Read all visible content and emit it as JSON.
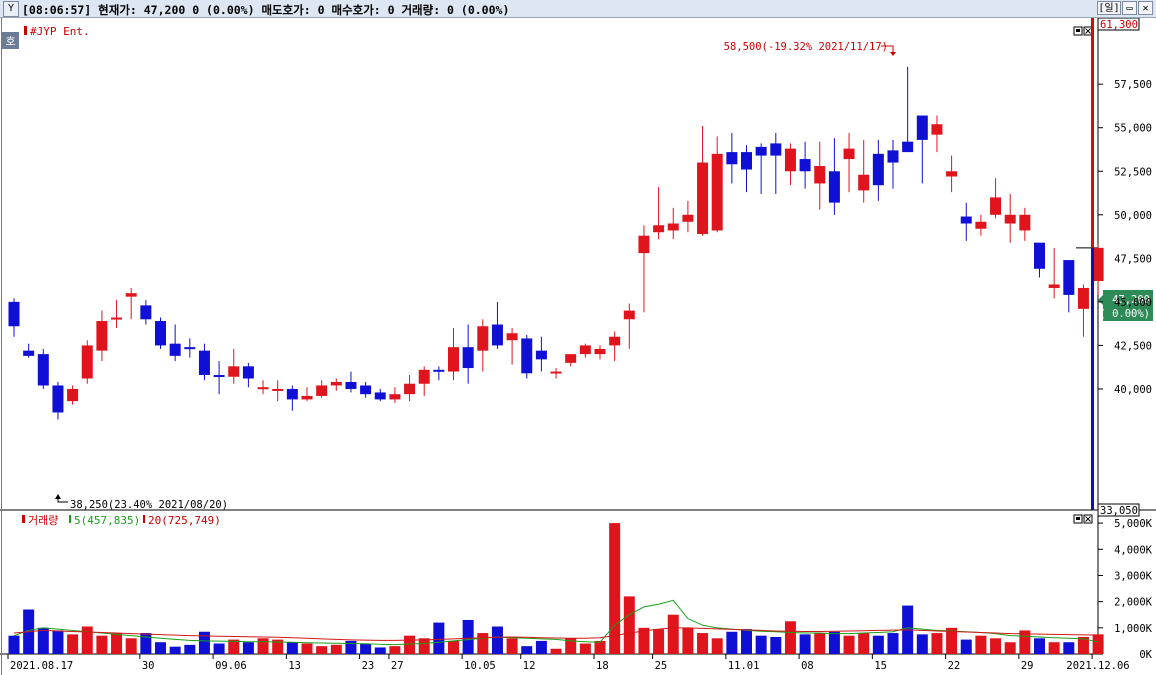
{
  "window": {
    "status_text": "[08:06:57] 현재가: 47,200 0 (0.00%) 매도호가: 0 매수호가: 0 거래량: 0 (0.00%)",
    "period_button": "[일]",
    "logo_glyph": "Y",
    "side_tab": "호"
  },
  "price_panel": {
    "legend": "#JYP Ent.",
    "legend_color": "#cc0000",
    "axis_top": "61,300",
    "axis_bottom": "33,050",
    "ticks": [
      "57,500",
      "55,000",
      "52,500",
      "50,000",
      "47,500",
      "45,000",
      "42,500",
      "40,000"
    ],
    "current_label": "47,200",
    "current_change": "( 0.00%)",
    "high_annotation": "58,500(-19.32% 2021/11/17)",
    "low_annotation": "38,250(23.40% 2021/08/20)"
  },
  "volume_panel": {
    "legend_title": "거래량",
    "ma5_label": "5(457,835)",
    "ma20_label": "20(725,749)",
    "ticks": [
      "5,000K",
      "4,000K",
      "3,000K",
      "2,000K",
      "1,000K",
      "0K"
    ]
  },
  "x_axis": {
    "labels": [
      "2021.08.17",
      "30",
      "09.06",
      "13",
      "23",
      "27",
      "10.05",
      "12",
      "18",
      "25",
      "11.01",
      "08",
      "15",
      "22",
      "29",
      "2021.12.06"
    ]
  },
  "colors": {
    "up": "#e0141c",
    "down": "#0f0fd6",
    "ma5": "#18a018",
    "ma20": "#d01818",
    "current": "#2e8b57"
  },
  "chart_data": [
    {
      "type": "candlestick",
      "title": "#JYP Ent.",
      "ylim": [
        33050,
        61300
      ],
      "x": [
        "08.17",
        "08.18",
        "08.19",
        "08.20",
        "08.23",
        "08.24",
        "08.25",
        "08.26",
        "08.27",
        "08.30",
        "08.31",
        "09.01",
        "09.02",
        "09.03",
        "09.06",
        "09.07",
        "09.08",
        "09.09",
        "09.10",
        "09.13",
        "09.14",
        "09.15",
        "09.16",
        "09.17",
        "09.23",
        "09.24",
        "09.27",
        "09.28",
        "09.29",
        "09.30",
        "10.01",
        "10.05",
        "10.06",
        "10.07",
        "10.08",
        "10.12",
        "10.13",
        "10.14",
        "10.15",
        "10.18",
        "10.19",
        "10.20",
        "10.21",
        "10.22",
        "10.25",
        "10.26",
        "10.27",
        "10.28",
        "10.29",
        "11.01",
        "11.02",
        "11.03",
        "11.04",
        "11.05",
        "11.08",
        "11.09",
        "11.10",
        "11.11",
        "11.12",
        "11.15",
        "11.16",
        "11.17",
        "11.18",
        "11.19",
        "11.22",
        "11.23",
        "11.24",
        "11.25",
        "11.26",
        "11.29",
        "11.30",
        "12.01",
        "12.02",
        "12.03",
        "12.06"
      ],
      "open": [
        45000,
        42200,
        42000,
        40200,
        39300,
        40600,
        42200,
        44100,
        45300,
        44800,
        43900,
        42600,
        42400,
        42200,
        40800,
        40700,
        41300,
        40100,
        40000,
        40000,
        39400,
        39600,
        40200,
        40400,
        40200,
        39800,
        39400,
        39700,
        40300,
        41100,
        41000,
        42400,
        42200,
        43700,
        42800,
        42900,
        42200,
        40900,
        41500,
        42000,
        42000,
        42500,
        44000,
        47800,
        49000,
        49100,
        49600,
        48900,
        49100,
        53600,
        53600,
        53900,
        54100,
        52500,
        53200,
        51800,
        52500,
        53200,
        51400,
        53500,
        53700,
        54200,
        55700,
        54600,
        52200,
        49900,
        49200,
        50000,
        49500,
        49100,
        48400,
        45800,
        47400,
        44600,
        46200
      ],
      "close": [
        43600,
        41900,
        40200,
        38650,
        40000,
        42500,
        43900,
        44100,
        45500,
        44000,
        42500,
        41900,
        42300,
        40800,
        40700,
        41300,
        40600,
        40100,
        40000,
        39400,
        39600,
        40200,
        40400,
        40000,
        39700,
        39400,
        39700,
        40300,
        41100,
        41000,
        42400,
        41200,
        43600,
        42500,
        43200,
        40900,
        41700,
        41000,
        42000,
        42500,
        42300,
        43000,
        44500,
        48800,
        49400,
        49500,
        50000,
        53000,
        53500,
        52900,
        52600,
        53400,
        53400,
        53800,
        52500,
        52800,
        50700,
        53800,
        52300,
        51700,
        53000,
        53600,
        54300,
        55200,
        52500,
        49500,
        49600,
        51000,
        50000,
        50000,
        46900,
        46000,
        45400,
        45800,
        48100
      ],
      "high": [
        45200,
        42600,
        42300,
        40400,
        40200,
        42800,
        44500,
        45100,
        45800,
        45100,
        44100,
        43700,
        42900,
        42600,
        41600,
        42300,
        41500,
        40500,
        40500,
        40200,
        40100,
        40500,
        40600,
        41000,
        40400,
        40000,
        40100,
        40800,
        41300,
        41300,
        43500,
        43700,
        44000,
        45000,
        43500,
        43100,
        43000,
        41200,
        42000,
        42600,
        42500,
        43300,
        44900,
        49400,
        51600,
        50400,
        50800,
        55100,
        54500,
        54700,
        54000,
        54100,
        54700,
        54100,
        54200,
        54200,
        54400,
        54700,
        54300,
        54300,
        54300,
        58500,
        55700,
        55700,
        53400,
        50700,
        50000,
        52100,
        51200,
        50400,
        47000,
        48100,
        46700,
        46000,
        48300
      ],
      "low": [
        43000,
        41800,
        40000,
        38250,
        39100,
        40300,
        41600,
        43500,
        44000,
        43700,
        42300,
        41600,
        41800,
        40500,
        39700,
        40300,
        40100,
        39700,
        39300,
        38750,
        39300,
        39500,
        39900,
        39800,
        39500,
        39300,
        39200,
        39300,
        39600,
        40500,
        40500,
        40300,
        41000,
        42300,
        41400,
        40600,
        41000,
        40600,
        41300,
        41800,
        41700,
        41600,
        42300,
        44400,
        48600,
        48600,
        49000,
        48800,
        49000,
        51800,
        51300,
        51200,
        51200,
        51700,
        51500,
        50300,
        50000,
        51300,
        50700,
        50800,
        51500,
        53600,
        51800,
        53600,
        51300,
        48500,
        48800,
        49800,
        48400,
        48500,
        46400,
        45200,
        44400,
        43000,
        45400
      ],
      "annotations": [
        "58,500(-19.32% 2021/11/17)",
        "38,250(23.40% 2021/08/20)"
      ]
    },
    {
      "type": "bar",
      "title": "거래량",
      "ylim": [
        0,
        5500000
      ],
      "values": [
        700000,
        1700000,
        1000000,
        900000,
        750000,
        1050000,
        700000,
        800000,
        600000,
        800000,
        450000,
        280000,
        350000,
        850000,
        400000,
        550000,
        450000,
        600000,
        550000,
        450000,
        400000,
        300000,
        350000,
        500000,
        400000,
        250000,
        300000,
        700000,
        600000,
        1200000,
        500000,
        1300000,
        800000,
        1050000,
        600000,
        300000,
        500000,
        200000,
        600000,
        400000,
        500000,
        5000000,
        2200000,
        1000000,
        950000,
        1500000,
        1000000,
        800000,
        600000,
        850000,
        950000,
        700000,
        650000,
        1250000,
        750000,
        800000,
        850000,
        700000,
        800000,
        700000,
        800000,
        1850000,
        750000,
        800000,
        1000000,
        550000,
        700000,
        600000,
        450000,
        900000,
        600000,
        450000,
        450000,
        650000,
        750000
      ],
      "series": [
        {
          "name": "5",
          "values": [
            700000,
            900000,
            1000000,
            950000,
            900000,
            850000,
            800000,
            750000,
            700000,
            650000,
            600000,
            560000,
            520000,
            500000,
            490000,
            480000,
            470000,
            470000,
            460000,
            450000,
            430000,
            420000,
            410000,
            400000,
            390000,
            370000,
            360000,
            380000,
            400000,
            450000,
            500000,
            550000,
            600000,
            650000,
            620000,
            600000,
            580000,
            560000,
            500000,
            470000,
            450000,
            1100000,
            1500000,
            1800000,
            1900000,
            2050000,
            1350000,
            1100000,
            1000000,
            950000,
            900000,
            870000,
            850000,
            820000,
            800000,
            800000,
            780000,
            780000,
            800000,
            820000,
            850000,
            1000000,
            950000,
            900000,
            880000,
            850000,
            820000,
            780000,
            700000,
            680000,
            650000,
            620000,
            600000,
            580000,
            457835
          ]
        },
        {
          "name": "20",
          "values": [
            800000,
            850000,
            900000,
            880000,
            860000,
            840000,
            820000,
            800000,
            780000,
            760000,
            740000,
            720000,
            700000,
            690000,
            680000,
            670000,
            660000,
            650000,
            640000,
            620000,
            600000,
            580000,
            560000,
            540000,
            530000,
            520000,
            520000,
            530000,
            540000,
            560000,
            580000,
            600000,
            620000,
            640000,
            650000,
            640000,
            620000,
            610000,
            600000,
            600000,
            620000,
            700000,
            800000,
            880000,
            950000,
            1000000,
            1000000,
            980000,
            960000,
            940000,
            920000,
            900000,
            880000,
            870000,
            860000,
            860000,
            870000,
            880000,
            890000,
            900000,
            910000,
            920000,
            900000,
            880000,
            860000,
            840000,
            820000,
            800000,
            780000,
            770000,
            760000,
            750000,
            740000,
            730000,
            725749
          ]
        }
      ]
    }
  ]
}
